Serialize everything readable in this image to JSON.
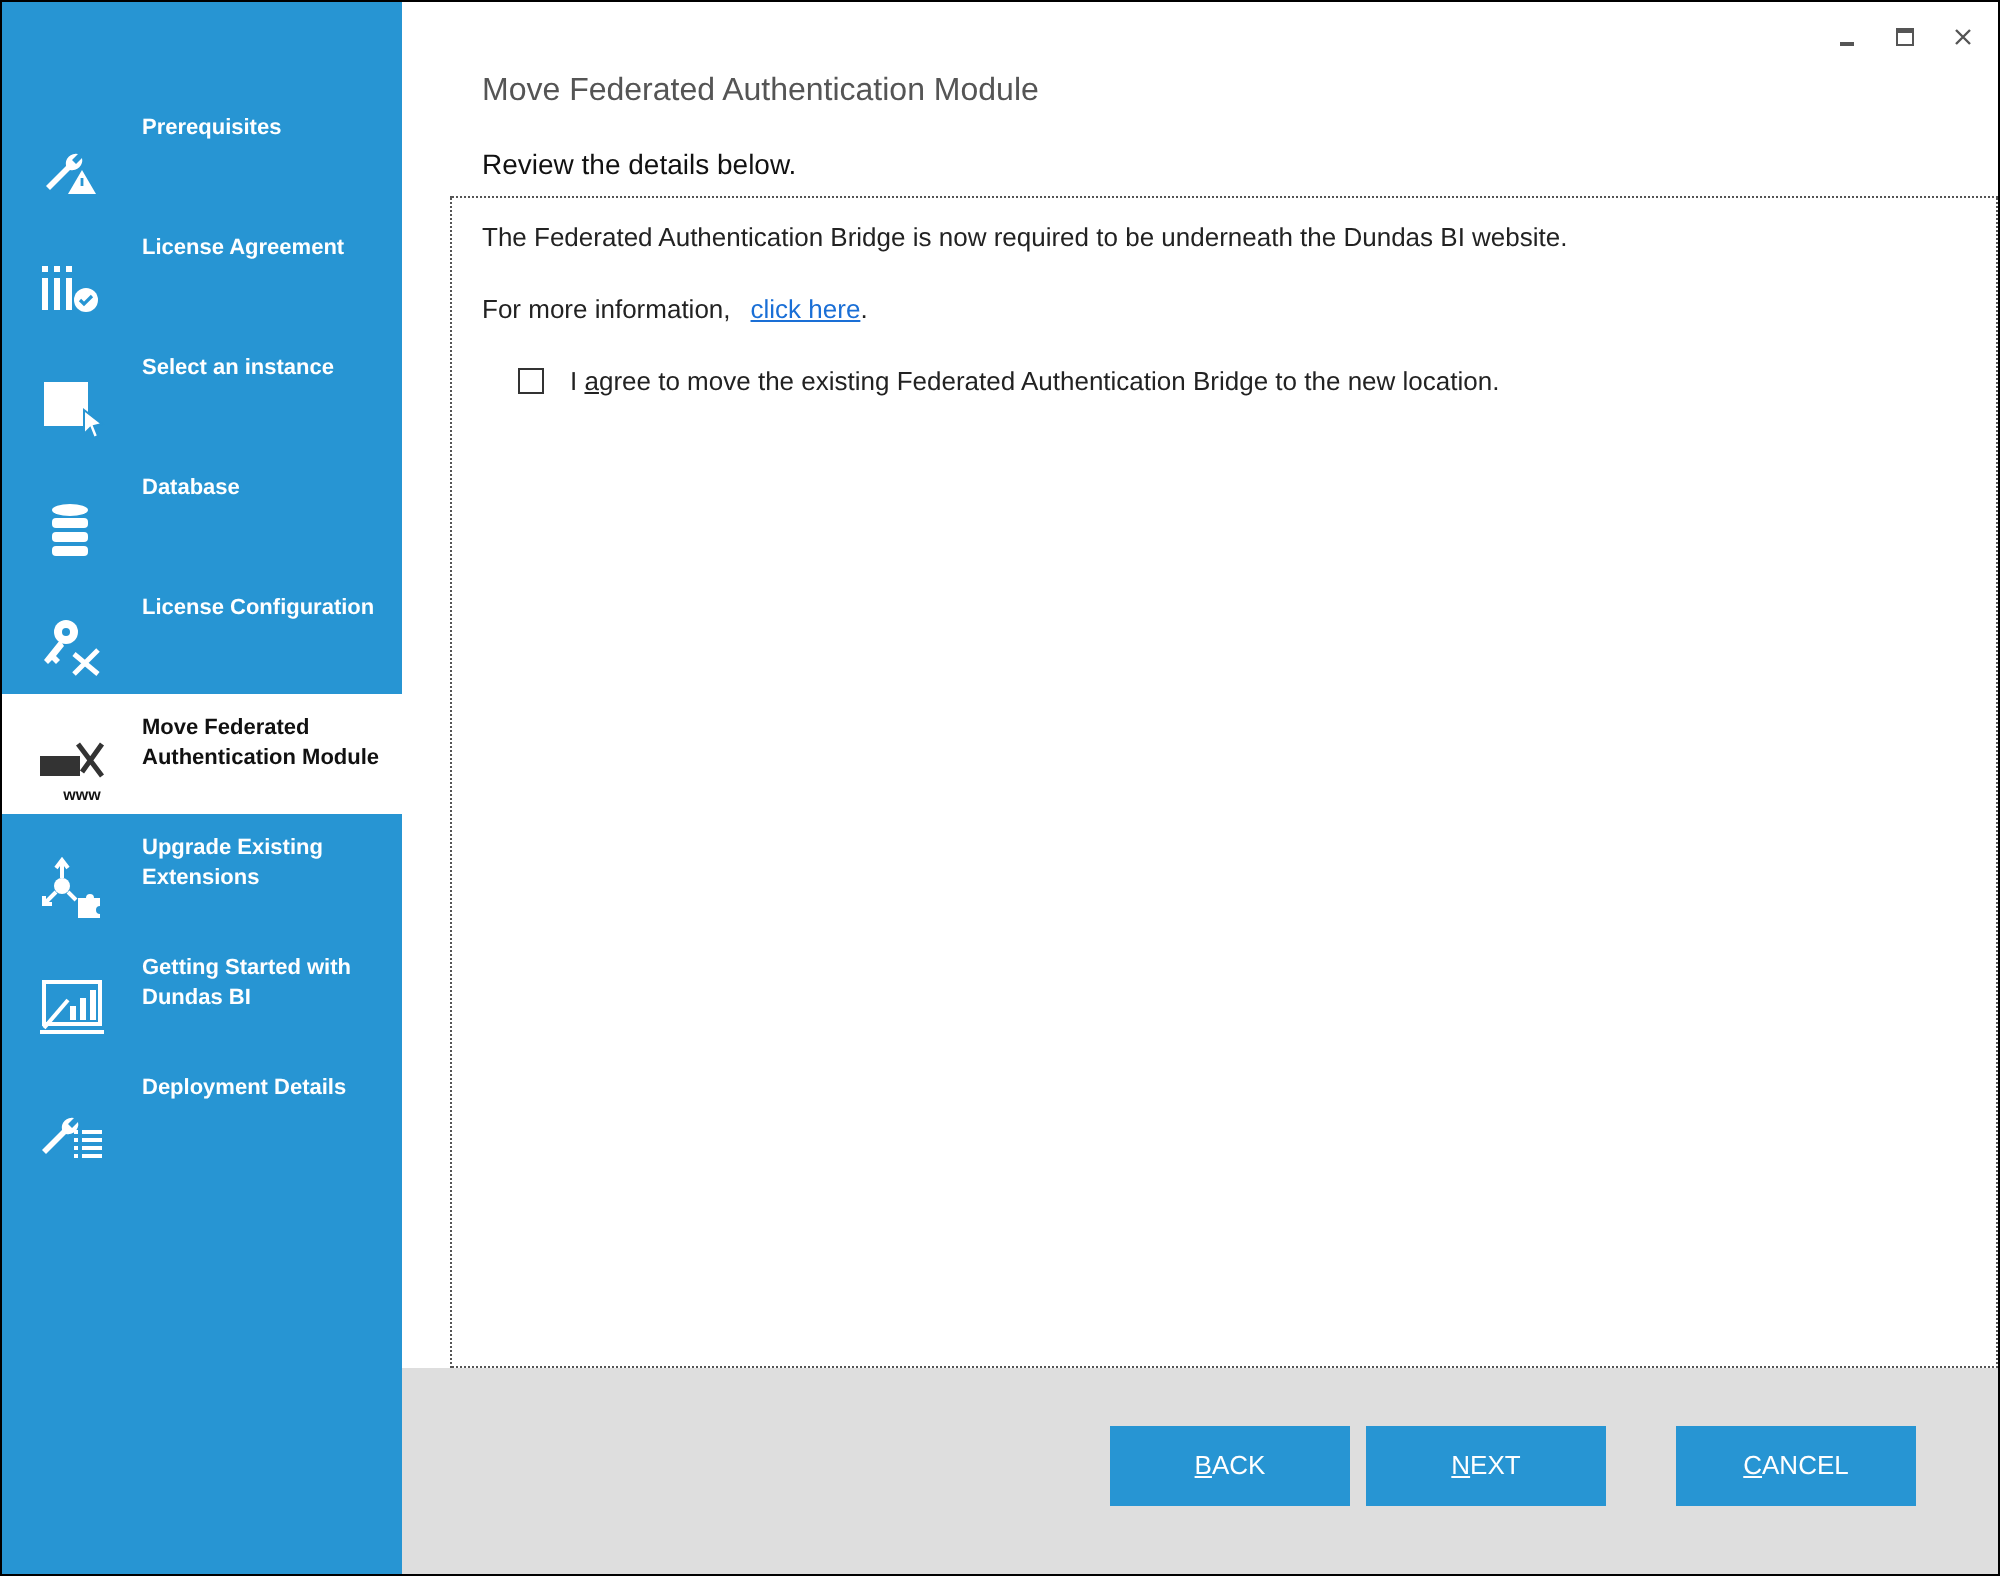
{
  "sidebar": {
    "items": [
      {
        "label": "Prerequisites",
        "selected": false
      },
      {
        "label": "License Agreement",
        "selected": false
      },
      {
        "label": "Select an instance",
        "selected": false
      },
      {
        "label": "Database",
        "selected": false
      },
      {
        "label": "License Configuration",
        "selected": false
      },
      {
        "label": "Move Federated Authentication Module",
        "icon_caption": "www",
        "selected": true
      },
      {
        "label": "Upgrade Existing Extensions",
        "selected": false
      },
      {
        "label": "Getting Started with Dundas BI",
        "selected": false
      },
      {
        "label": "Deployment Details",
        "selected": false
      }
    ]
  },
  "page": {
    "title": "Move Federated Authentication Module",
    "subtitle": "Review the details below.",
    "description": "The Federated Authentication Bridge is now required to be underneath the Dundas BI website.",
    "info_text": "For more information,",
    "link": "click here",
    "link_suffix": ".",
    "checkbox": {
      "label": "I agree to move the existing Federated Authentication Bridge to the new location.",
      "checked": false
    }
  },
  "buttons": [
    "BACK",
    "NEXT",
    "CANCEL"
  ]
}
